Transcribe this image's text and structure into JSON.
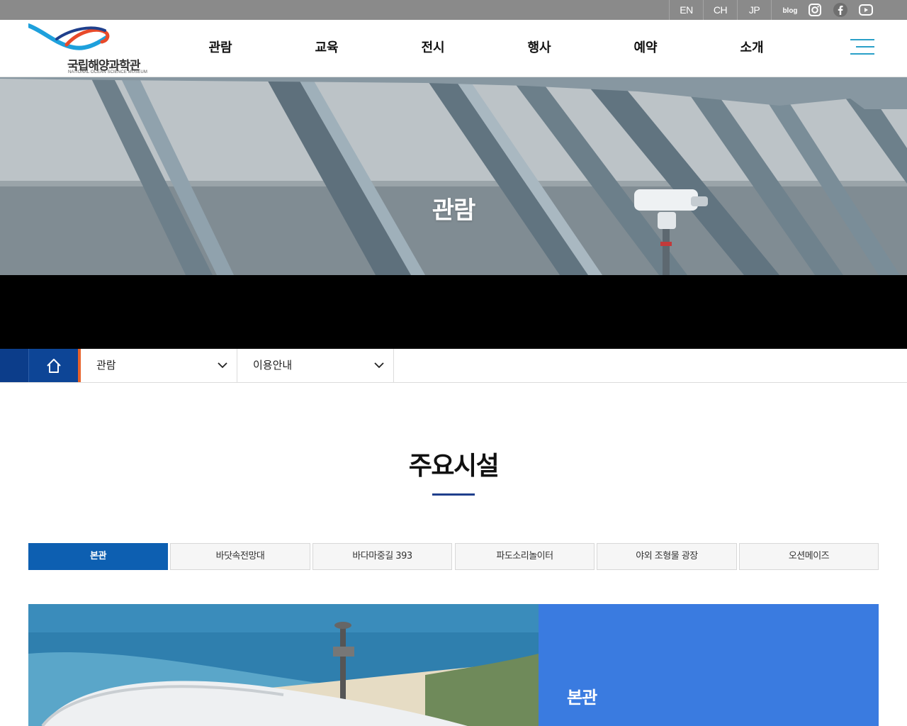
{
  "languages": [
    "EN",
    "CH",
    "JP"
  ],
  "social": {
    "blog_label": "blog",
    "icons": [
      "blog-icon",
      "instagram-icon",
      "facebook-icon",
      "youtube-icon"
    ]
  },
  "logo": {
    "name_ko": "국립해양과학관",
    "name_en": "NATIONAL OCEAN SCIENCE MUSEUM"
  },
  "nav": [
    "관람",
    "교육",
    "전시",
    "행사",
    "예약",
    "소개"
  ],
  "hero": {
    "title": "관람"
  },
  "location": {
    "level1": "관람",
    "level2": "이용안내"
  },
  "section": {
    "title": "주요시설"
  },
  "tabs": [
    {
      "label": "본관",
      "active": true
    },
    {
      "label": "바닷속전망대",
      "active": false
    },
    {
      "label": "바다마중길 393",
      "active": false
    },
    {
      "label": "파도소리놀이터",
      "active": false
    },
    {
      "label": "야외 조형물 광장",
      "active": false
    },
    {
      "label": "오션메이즈",
      "active": false
    }
  ],
  "content": {
    "title": "본관"
  },
  "colors": {
    "utilbar": "#8a8a8a",
    "home_button": "#0d4596",
    "accent_orange": "#e8622a",
    "active_tab": "#0d5fb1",
    "content_box": "#3a7be0",
    "underline": "#1f3f8c"
  }
}
